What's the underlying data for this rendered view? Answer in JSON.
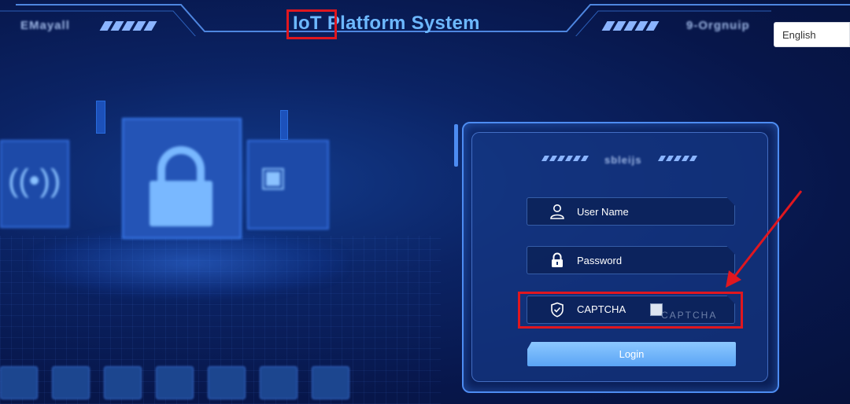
{
  "header": {
    "title": "IoT Platform System",
    "left_blurred_text": "EMayall",
    "right_blurred_text": "9-Orgnuip",
    "language": {
      "selected": "English"
    }
  },
  "login": {
    "heading_blurred": "sbleijs",
    "username_placeholder": "User Name",
    "password_placeholder": "Password",
    "captcha_placeholder": "CAPTCHA",
    "captcha_image_alt": "CAPTCHA",
    "login_button": "Login"
  },
  "icons": {
    "username": "user-icon",
    "password": "lock-icon",
    "captcha": "shield-check-icon"
  },
  "colors": {
    "background": "#07164a",
    "title": "#6db8ff",
    "button": "#6fb4fa",
    "highlight": "#e0171f"
  }
}
